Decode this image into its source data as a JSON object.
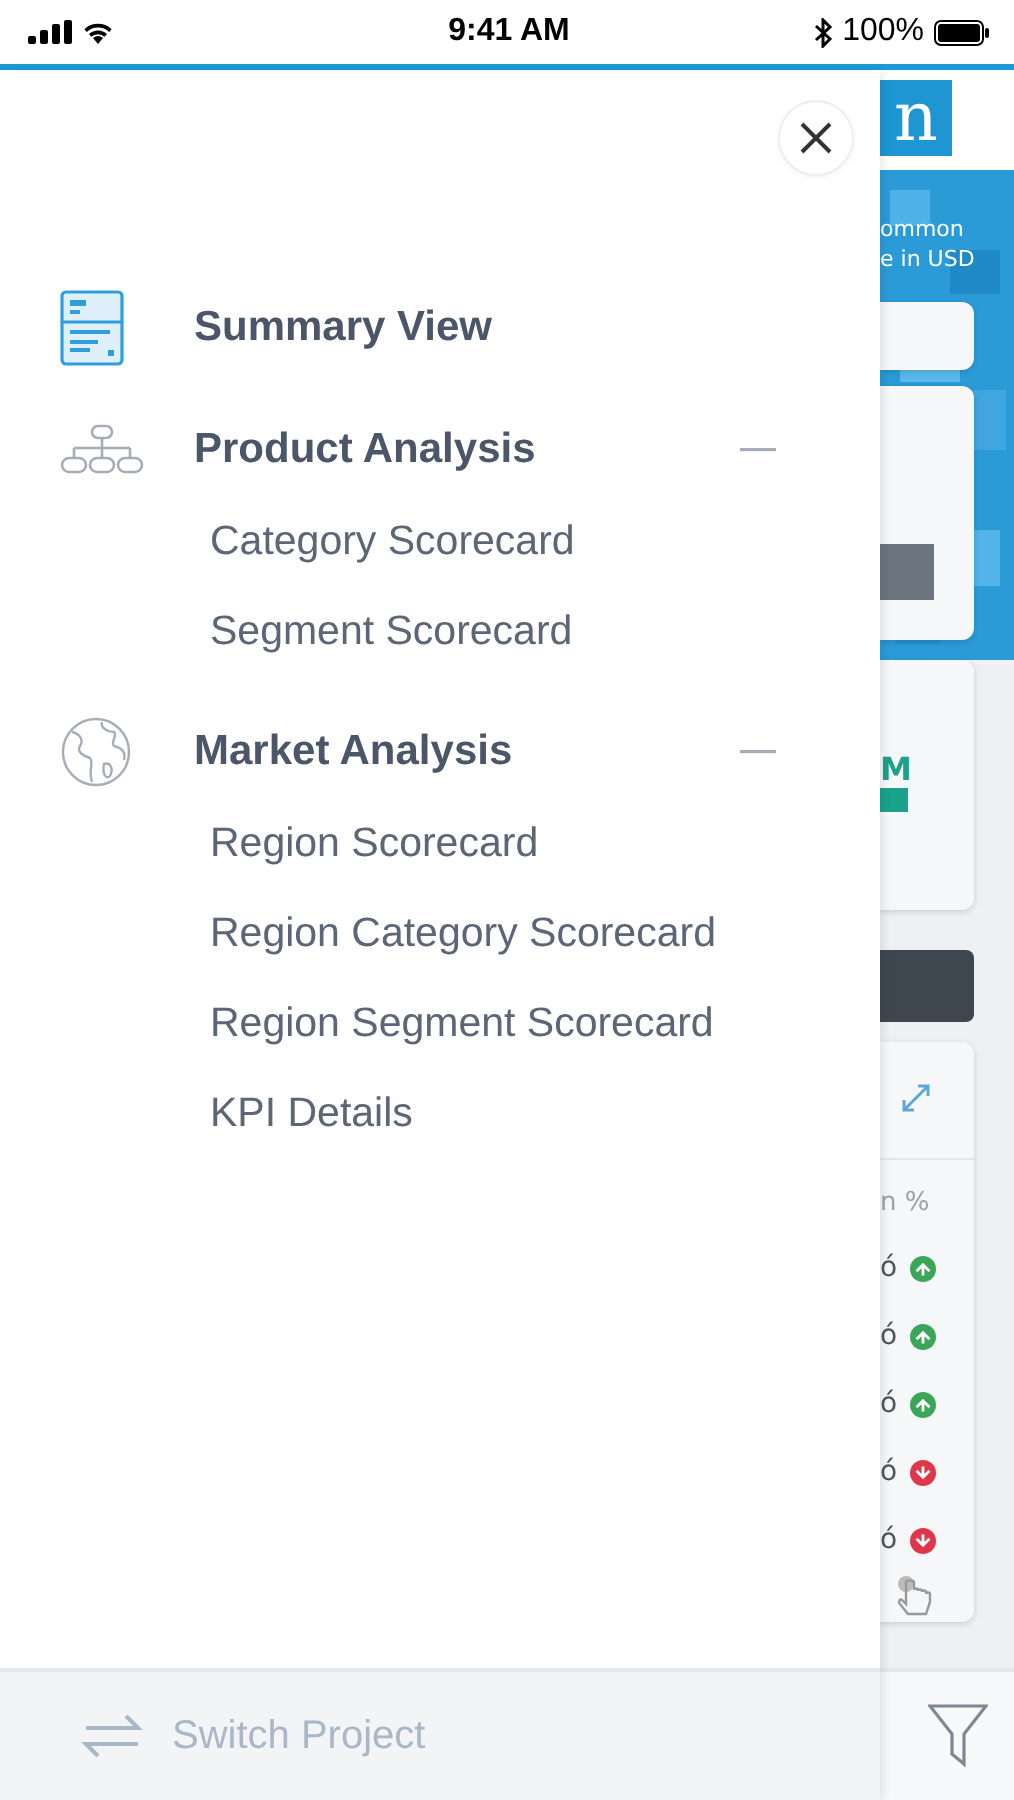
{
  "status_bar": {
    "time": "9:41 AM",
    "battery": "100%"
  },
  "menu": {
    "sections": [
      {
        "title": "Summary View"
      },
      {
        "title": "Product Analysis",
        "expanded": true,
        "children": [
          {
            "label": "Category Scorecard"
          },
          {
            "label": "Segment Scorecard"
          }
        ]
      },
      {
        "title": "Market Analysis",
        "expanded": true,
        "children": [
          {
            "label": "Region Scorecard"
          },
          {
            "label": "Region Category Scorecard"
          },
          {
            "label": "Region Segment Scorecard"
          },
          {
            "label": "KPI Details"
          }
        ]
      }
    ]
  },
  "footer": {
    "label": "Switch Project",
    "disabled": true
  },
  "background_app": {
    "logo": "n",
    "banner_lines": [
      "ommon",
      "e in USD"
    ],
    "card_text": "M",
    "column_header": "n %",
    "rows": [
      {
        "value": "ó",
        "kind": "up"
      },
      {
        "value": "ó",
        "kind": "up"
      },
      {
        "value": "ó",
        "kind": "up"
      },
      {
        "value": "ó",
        "kind": "down"
      },
      {
        "value": "ó",
        "kind": "down"
      }
    ]
  }
}
